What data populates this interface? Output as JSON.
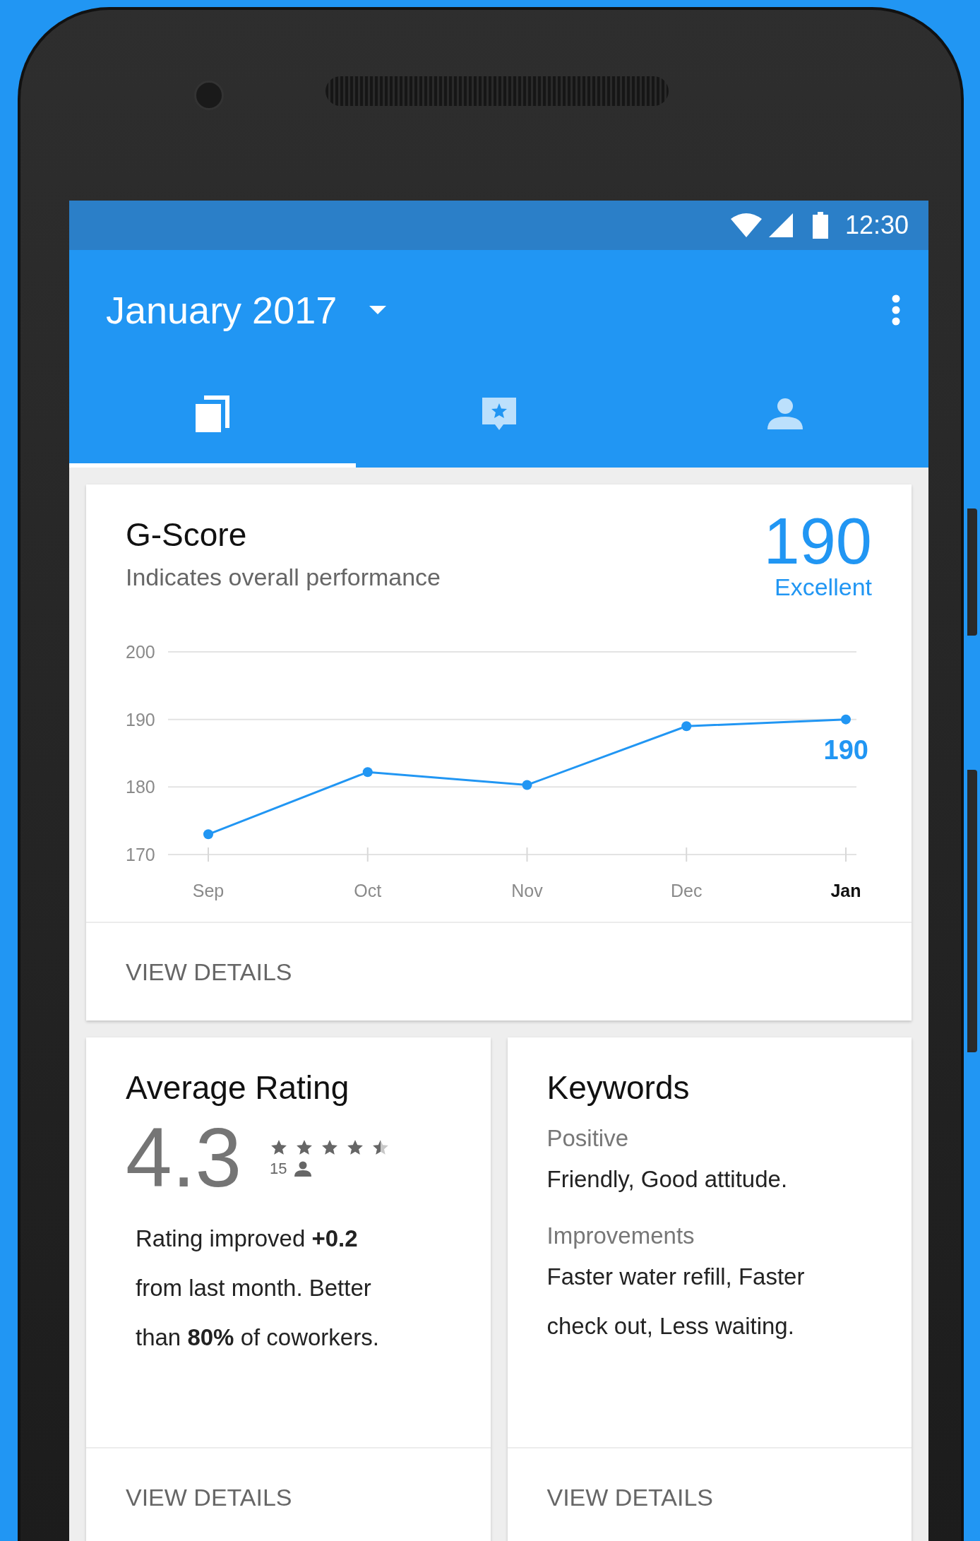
{
  "status_bar": {
    "time": "12:30"
  },
  "toolbar": {
    "title": "January 2017"
  },
  "tabs": [
    {
      "kind": "pages",
      "selected": true
    },
    {
      "kind": "review",
      "selected": false
    },
    {
      "kind": "person",
      "selected": false
    }
  ],
  "gscore_card": {
    "title": "G-Score",
    "subtitle": "Indicates overall performance",
    "score": "190",
    "score_label": "Excellent",
    "chart_data": {
      "type": "line",
      "categories": [
        "Sep",
        "Oct",
        "Nov",
        "Dec",
        "Jan"
      ],
      "series": [
        {
          "color": "#2196f3",
          "marker": "circle",
          "values": [
            173,
            182.2,
            180.3,
            189,
            190
          ]
        }
      ],
      "ylim": [
        170,
        200
      ],
      "yticks": [
        170,
        180,
        190,
        200
      ],
      "annotations": [
        {
          "x": "Jan",
          "y": 190,
          "text": "190"
        }
      ]
    },
    "action": "VIEW DETAILS"
  },
  "rating_card": {
    "title": "Average Rating",
    "value": "4.3",
    "stars": 4.5,
    "count": "15",
    "text": "Rating improved **+0.2** from last month. Better than **80%** of coworkers.",
    "action": "VIEW DETAILS"
  },
  "keywords_card": {
    "title": "Keywords",
    "groups": [
      {
        "label": "Positive",
        "text": "Friendly, Good attitude."
      },
      {
        "label": "Improvements",
        "text": "Faster water refill, Faster check out, Less waiting."
      }
    ],
    "action": "VIEW DETAILS"
  }
}
